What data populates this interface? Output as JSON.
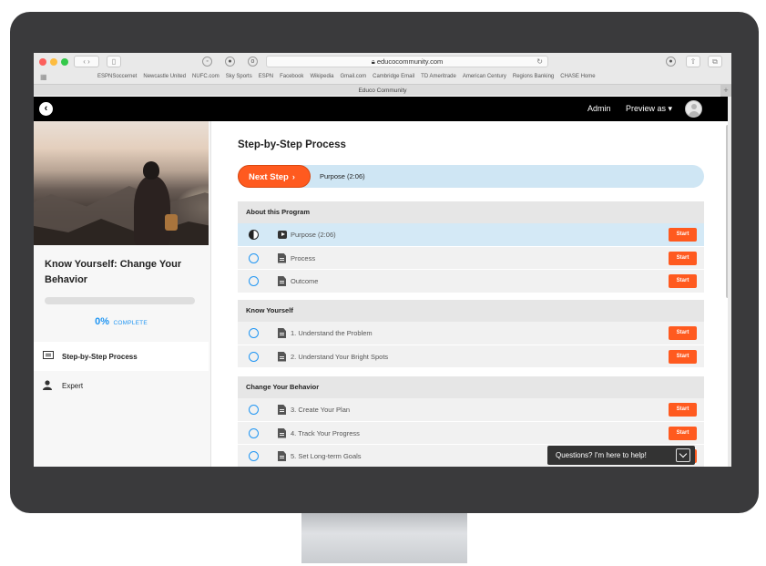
{
  "browser": {
    "url": "educocommunity.com",
    "tab_title": "Educo Community",
    "bookmarks": [
      "ESPNSoccernet",
      "Newcastle United",
      "NUFC.com",
      "Sky Sports",
      "ESPN",
      "Facebook",
      "Wikipedia",
      "Gmail.com",
      "Cambridge Email",
      "TD Ameritrade",
      "American Century",
      "Regions Banking",
      "CHASE Home"
    ]
  },
  "topbar": {
    "admin_label": "Admin",
    "preview_label": "Preview as ▾"
  },
  "sidebar": {
    "course_title": "Know Yourself: Change Your Behavior",
    "progress_percent": 0,
    "progress_pct_label": "0%",
    "progress_complete_label": "COMPLETE",
    "nav": [
      {
        "label": "Step-by-Step Process",
        "icon": "list-icon",
        "active": true
      },
      {
        "label": "Expert",
        "icon": "user-icon",
        "active": false
      }
    ]
  },
  "main": {
    "title": "Step-by-Step Process",
    "next_step_label": "Next Step",
    "next_step_target": "Purpose (2:06)",
    "sections": [
      {
        "title": "About this Program",
        "items": [
          {
            "label": "Purpose (2:06)",
            "icon": "video-icon",
            "status": "in-progress",
            "action": "Start"
          },
          {
            "label": "Process",
            "icon": "document-icon",
            "status": "not-started",
            "action": "Start"
          },
          {
            "label": "Outcome",
            "icon": "document-icon",
            "status": "not-started",
            "action": "Start"
          }
        ]
      },
      {
        "title": "Know Yourself",
        "items": [
          {
            "label": "1. Understand the Problem",
            "icon": "document-icon",
            "status": "not-started",
            "action": "Start"
          },
          {
            "label": "2. Understand Your Bright Spots",
            "icon": "document-icon",
            "status": "not-started",
            "action": "Start"
          }
        ]
      },
      {
        "title": "Change Your Behavior",
        "items": [
          {
            "label": "3. Create Your Plan",
            "icon": "document-icon",
            "status": "not-started",
            "action": "Start"
          },
          {
            "label": "4. Track Your Progress",
            "icon": "document-icon",
            "status": "not-started",
            "action": "Start"
          },
          {
            "label": "5. Set Long-term Goals",
            "icon": "document-icon",
            "status": "not-started",
            "action": "Start"
          }
        ]
      }
    ]
  },
  "chat": {
    "label": "Questions? I'm here to help!"
  },
  "colors": {
    "accent_orange": "#ff5a1f",
    "accent_blue": "#2196f3",
    "active_row": "#d4e9f6",
    "topbar": "#000000"
  }
}
